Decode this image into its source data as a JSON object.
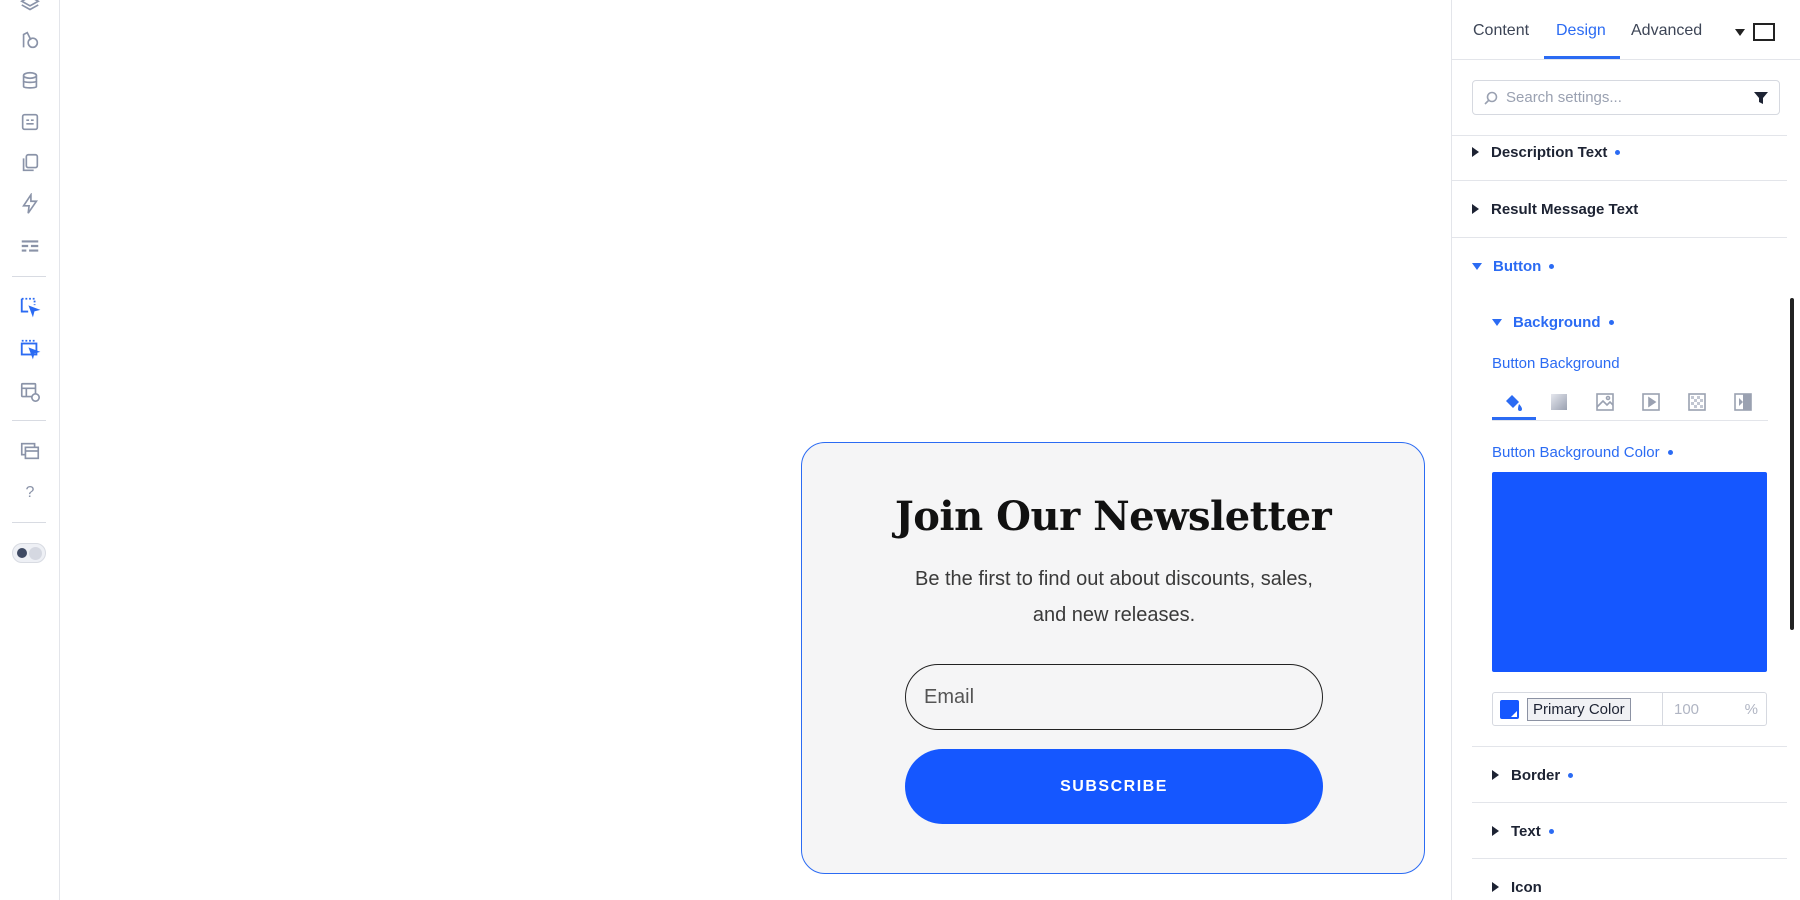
{
  "sidebar": {
    "icons": [
      "layers-icon",
      "palette-icon",
      "database-icon",
      "form-icon",
      "copy-icon",
      "lightning-icon",
      "menu-lines-icon",
      "select-cursor-icon",
      "select-multi-icon",
      "template-preview-icon",
      "windows-icon",
      "help-icon"
    ],
    "help_label": "?"
  },
  "panel": {
    "tabs": [
      "Content",
      "Design",
      "Advanced"
    ],
    "active_tab": "Design",
    "search_placeholder": "Search settings...",
    "sections": {
      "description_text": "Description Text",
      "result_message_text": "Result Message Text",
      "button": "Button",
      "background": "Background",
      "button_background": "Button Background",
      "button_background_color": "Button Background Color",
      "border": "Border",
      "text": "Text",
      "icon": "Icon"
    },
    "color": {
      "name": "Primary Color",
      "opacity_placeholder": "100",
      "unit": "%",
      "value": "#1557ff"
    },
    "bg_types": [
      "paint-bucket-icon",
      "gradient-icon",
      "image-icon",
      "video-icon",
      "pattern-icon",
      "overlay-icon"
    ]
  },
  "card": {
    "title": "Join Our Newsletter",
    "description": "Be the first to find out about discounts, sales, and new releases.",
    "email_placeholder": "Email",
    "button_label": "SUBSCRIBE"
  },
  "colors": {
    "accent": "#2b6bf3",
    "primary": "#1557ff"
  }
}
